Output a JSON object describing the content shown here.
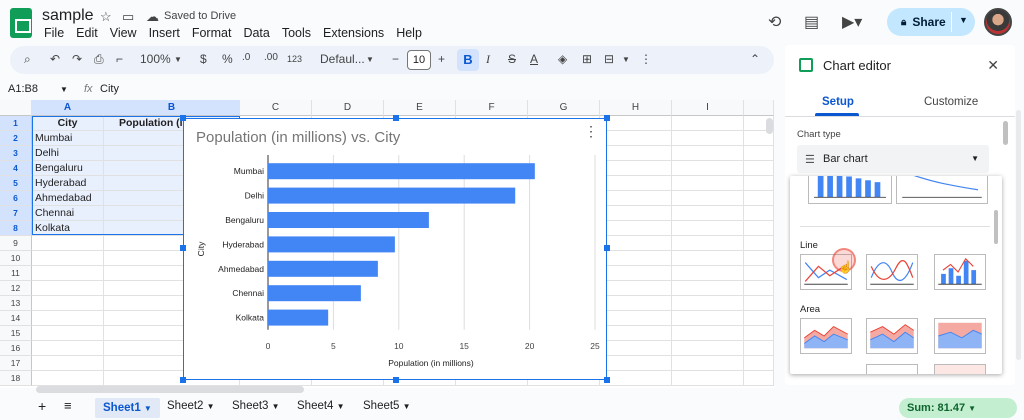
{
  "app": {
    "doc_title": "sample",
    "saved_status": "Saved to Drive",
    "menu": [
      "File",
      "Edit",
      "View",
      "Insert",
      "Format",
      "Data",
      "Tools",
      "Extensions",
      "Help"
    ],
    "share_label": "Share"
  },
  "toolbar": {
    "zoom": "100%",
    "currency": "$",
    "percent": "%",
    "dec_decrease": ".0",
    "dec_increase": ".00",
    "more_formats": "123",
    "font": "Defaul...",
    "font_size": "10",
    "bold": "B",
    "italic": "I",
    "strike": "S",
    "text_color": "A"
  },
  "formula_bar": {
    "name_box": "A1:B8",
    "fx": "fx",
    "content": "City"
  },
  "grid": {
    "columns": [
      "A",
      "B",
      "C",
      "D",
      "E",
      "F",
      "G",
      "H",
      "I"
    ],
    "rows": [
      "1",
      "2",
      "3",
      "4",
      "5",
      "6",
      "7",
      "8",
      "9",
      "10",
      "11",
      "12",
      "13",
      "14",
      "15",
      "16",
      "17",
      "18"
    ],
    "header_a": "City",
    "header_b": "Population (in",
    "cities": [
      "Mumbai",
      "Delhi",
      "Bengaluru",
      "Hyderabad",
      "Ahmedabad",
      "Chennai",
      "Kolkata"
    ]
  },
  "chart_data": {
    "type": "bar",
    "orientation": "horizontal",
    "title": "Population (in millions) vs. City",
    "xlabel": "Population (in millions)",
    "ylabel": "City",
    "categories": [
      "Mumbai",
      "Delhi",
      "Bengaluru",
      "Hyderabad",
      "Ahmedabad",
      "Chennai",
      "Kolkata"
    ],
    "values": [
      20.4,
      18.9,
      12.3,
      9.7,
      8.4,
      7.1,
      4.6
    ],
    "xlim": [
      0,
      25
    ],
    "xticks": [
      "0",
      "5",
      "10",
      "15",
      "20",
      "25"
    ],
    "bar_color": "#4285f4",
    "grid": true,
    "legend": "none"
  },
  "sheets": {
    "tabs": [
      "Sheet1",
      "Sheet2",
      "Sheet3",
      "Sheet4",
      "Sheet5"
    ],
    "active": "Sheet1",
    "sum": "Sum: 81.47"
  },
  "editor": {
    "title": "Chart editor",
    "tab_setup": "Setup",
    "tab_customize": "Customize",
    "chart_type_label": "Chart type",
    "chart_type_value": "Bar chart",
    "section_line": "Line",
    "section_area": "Area"
  }
}
